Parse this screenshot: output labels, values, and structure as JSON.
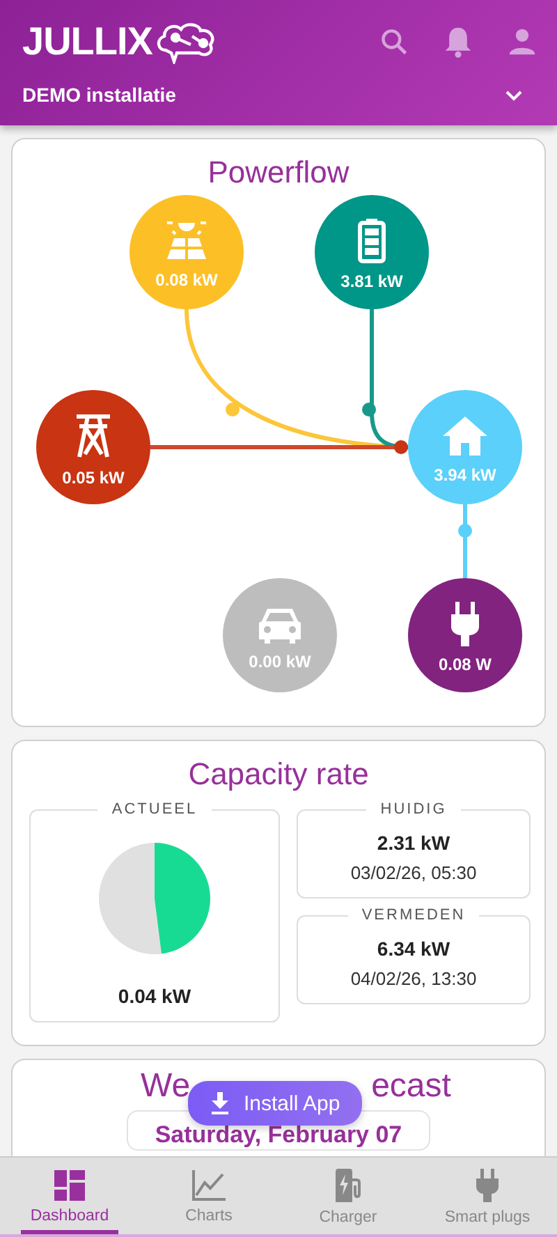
{
  "header": {
    "logo": "JULLIX",
    "installation": "DEMO installatie"
  },
  "powerflow": {
    "title": "Powerflow",
    "nodes": [
      {
        "kind": "solar",
        "value": "0.08 kW",
        "color": "#fcbf26"
      },
      {
        "kind": "battery",
        "value": "3.81 kW",
        "color": "#009688"
      },
      {
        "kind": "grid",
        "value": "0.05 kW",
        "color": "#c93412"
      },
      {
        "kind": "home",
        "value": "3.94 kW",
        "color": "#5ad0fa"
      },
      {
        "kind": "car",
        "value": "0.00 kW",
        "color": "#bdbdbd"
      },
      {
        "kind": "plug",
        "value": "0.08 W",
        "color": "#82237f"
      }
    ]
  },
  "capacity": {
    "title": "Capacity rate",
    "current": {
      "label": "ACTUEEL",
      "value": "0.04 kW"
    },
    "boxes": [
      {
        "label": "HUIDIG",
        "value": "2.31 kW",
        "date": "03/02/26, 05:30"
      },
      {
        "label": "VERMEDEN",
        "value": "6.34 kW",
        "date": "04/02/26, 13:30"
      }
    ]
  },
  "weather": {
    "title_visible_parts": [
      "We",
      "ecast"
    ],
    "day": "Saturday, February 07"
  },
  "install_button": "Install App",
  "nav": [
    {
      "kind": "dashboard",
      "label": "Dashboard",
      "selected": true
    },
    {
      "kind": "charts",
      "label": "Charts",
      "selected": false
    },
    {
      "kind": "charger",
      "label": "Charger",
      "selected": false
    },
    {
      "kind": "plugs",
      "label": "Smart plugs",
      "selected": false
    }
  ]
}
